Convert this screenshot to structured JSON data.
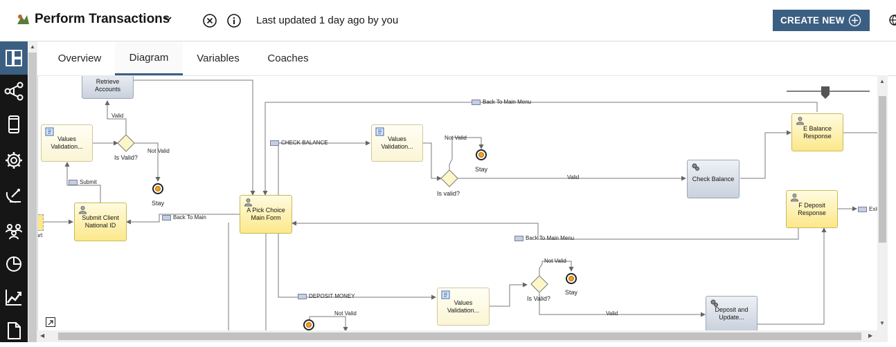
{
  "header": {
    "app_title": "Perform Transactions",
    "last_updated": "Last updated 1 day ago by you",
    "create_new_label": "CREATE NEW"
  },
  "tabs": [
    {
      "label": "Overview"
    },
    {
      "label": "Diagram"
    },
    {
      "label": "Variables"
    },
    {
      "label": "Coaches"
    }
  ],
  "sidenav": {
    "items": [
      "diagram-icon",
      "flow-icon",
      "mobile-icon",
      "gear-icon",
      "satellite-icon",
      "team-icon",
      "pie-chart-icon",
      "trend-chart-icon",
      "document-icon"
    ]
  },
  "diagram": {
    "nodes": {
      "retrieve_accounts": "Retrieve Accounts",
      "values_validation_1": "Values Validation...",
      "submit_client": "Submit Client National ID",
      "pick_choice": "A Pick Choice Main Form",
      "values_validation_2": "Values Validation...",
      "check_balance": "Check Balance",
      "e_balance": "E Balance Response",
      "f_deposit": "F Deposit Response",
      "values_validation_3": "Values Validation...",
      "deposit_update": "Deposit and Update...",
      "start_fragment": "art"
    },
    "gateways": {
      "g1": "Is Valid?",
      "g2": "Is valid?",
      "g3": "Is Valid?"
    },
    "labels": {
      "valid_1": "Valid",
      "not_valid_1": "Not Valid",
      "stay_1": "Stay",
      "not_valid_2": "Not Valid",
      "stay_2": "Stay",
      "valid_2": "Valid",
      "not_valid_3": "Not Valid",
      "stay_3": "Stay",
      "valid_3": "Valid",
      "not_valid_4": "Not Valid"
    },
    "links": {
      "back_to_main_menu_top": "Back To Main Menu",
      "check_balance": "CHECK BALANCE",
      "submit": "Submit",
      "back_to_main": "Back To Main",
      "back_to_main_menu_mid": "Back To Main Menu",
      "deposit_money": "DEPOSIT MONEY",
      "exit": "Exit"
    }
  }
}
